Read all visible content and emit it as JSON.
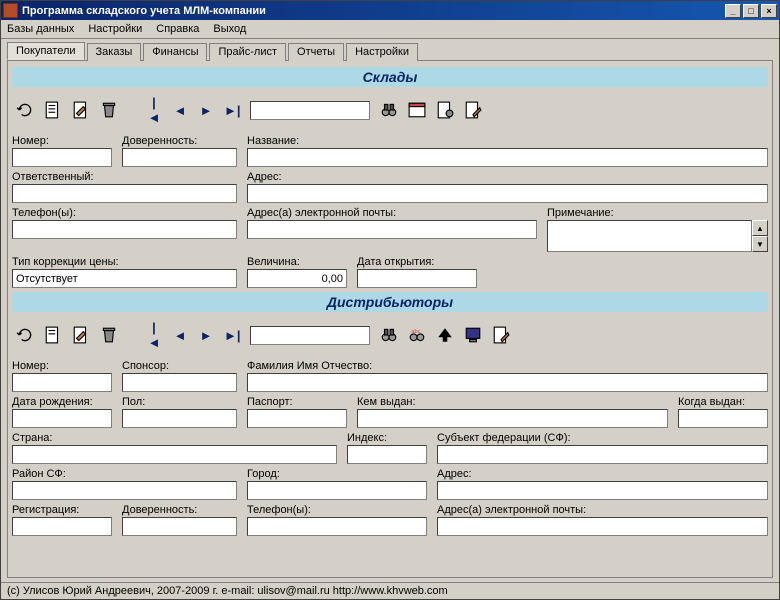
{
  "window": {
    "title": "Программа складского учета МЛМ-компании",
    "btn_min": "_",
    "btn_max": "□",
    "btn_close": "×"
  },
  "menu": [
    "Базы данных",
    "Настройки",
    "Справка",
    "Выход"
  ],
  "tabs": [
    "Покупатели",
    "Заказы",
    "Финансы",
    "Прайс-лист",
    "Отчеты",
    "Настройки"
  ],
  "activeTab": 0,
  "section1": {
    "title": "Склады",
    "search_value": "",
    "fields": {
      "number": "Номер:",
      "power": "Доверенность:",
      "name_lbl": "Название:",
      "responsible": "Ответственный:",
      "address": "Адрес:",
      "phones": "Телефон(ы):",
      "emails": "Адрес(а) электронной почты:",
      "note": "Примечание:",
      "price_correction": "Тип коррекции цены:",
      "value": "Величина:",
      "open_date": "Дата открытия:",
      "correction_value": "Отсутствует",
      "value_num": "0,00"
    }
  },
  "section2": {
    "title": "Дистрибьюторы",
    "search_value": "",
    "fields": {
      "number": "Номер:",
      "sponsor": "Спонсор:",
      "fio": "Фамилия Имя Отчество:",
      "birthdate": "Дата рождения:",
      "sex": "Пол:",
      "passport": "Паспорт:",
      "issued_by": "Кем выдан:",
      "when_issued": "Когда выдан:",
      "country": "Страна:",
      "index": "Индекс:",
      "subject": "Субъект федерации (СФ):",
      "district": "Район СФ:",
      "city": "Город:",
      "address": "Адрес:",
      "registration": "Регистрация:",
      "power": "Доверенность:",
      "phones": "Телефон(ы):",
      "emails": "Адрес(а) электронной почты:"
    }
  },
  "statusbar": "(c) Улисов Юрий Андреевич, 2007-2009 г.   e-mail: ulisov@mail.ru   http://www.khvweb.com"
}
